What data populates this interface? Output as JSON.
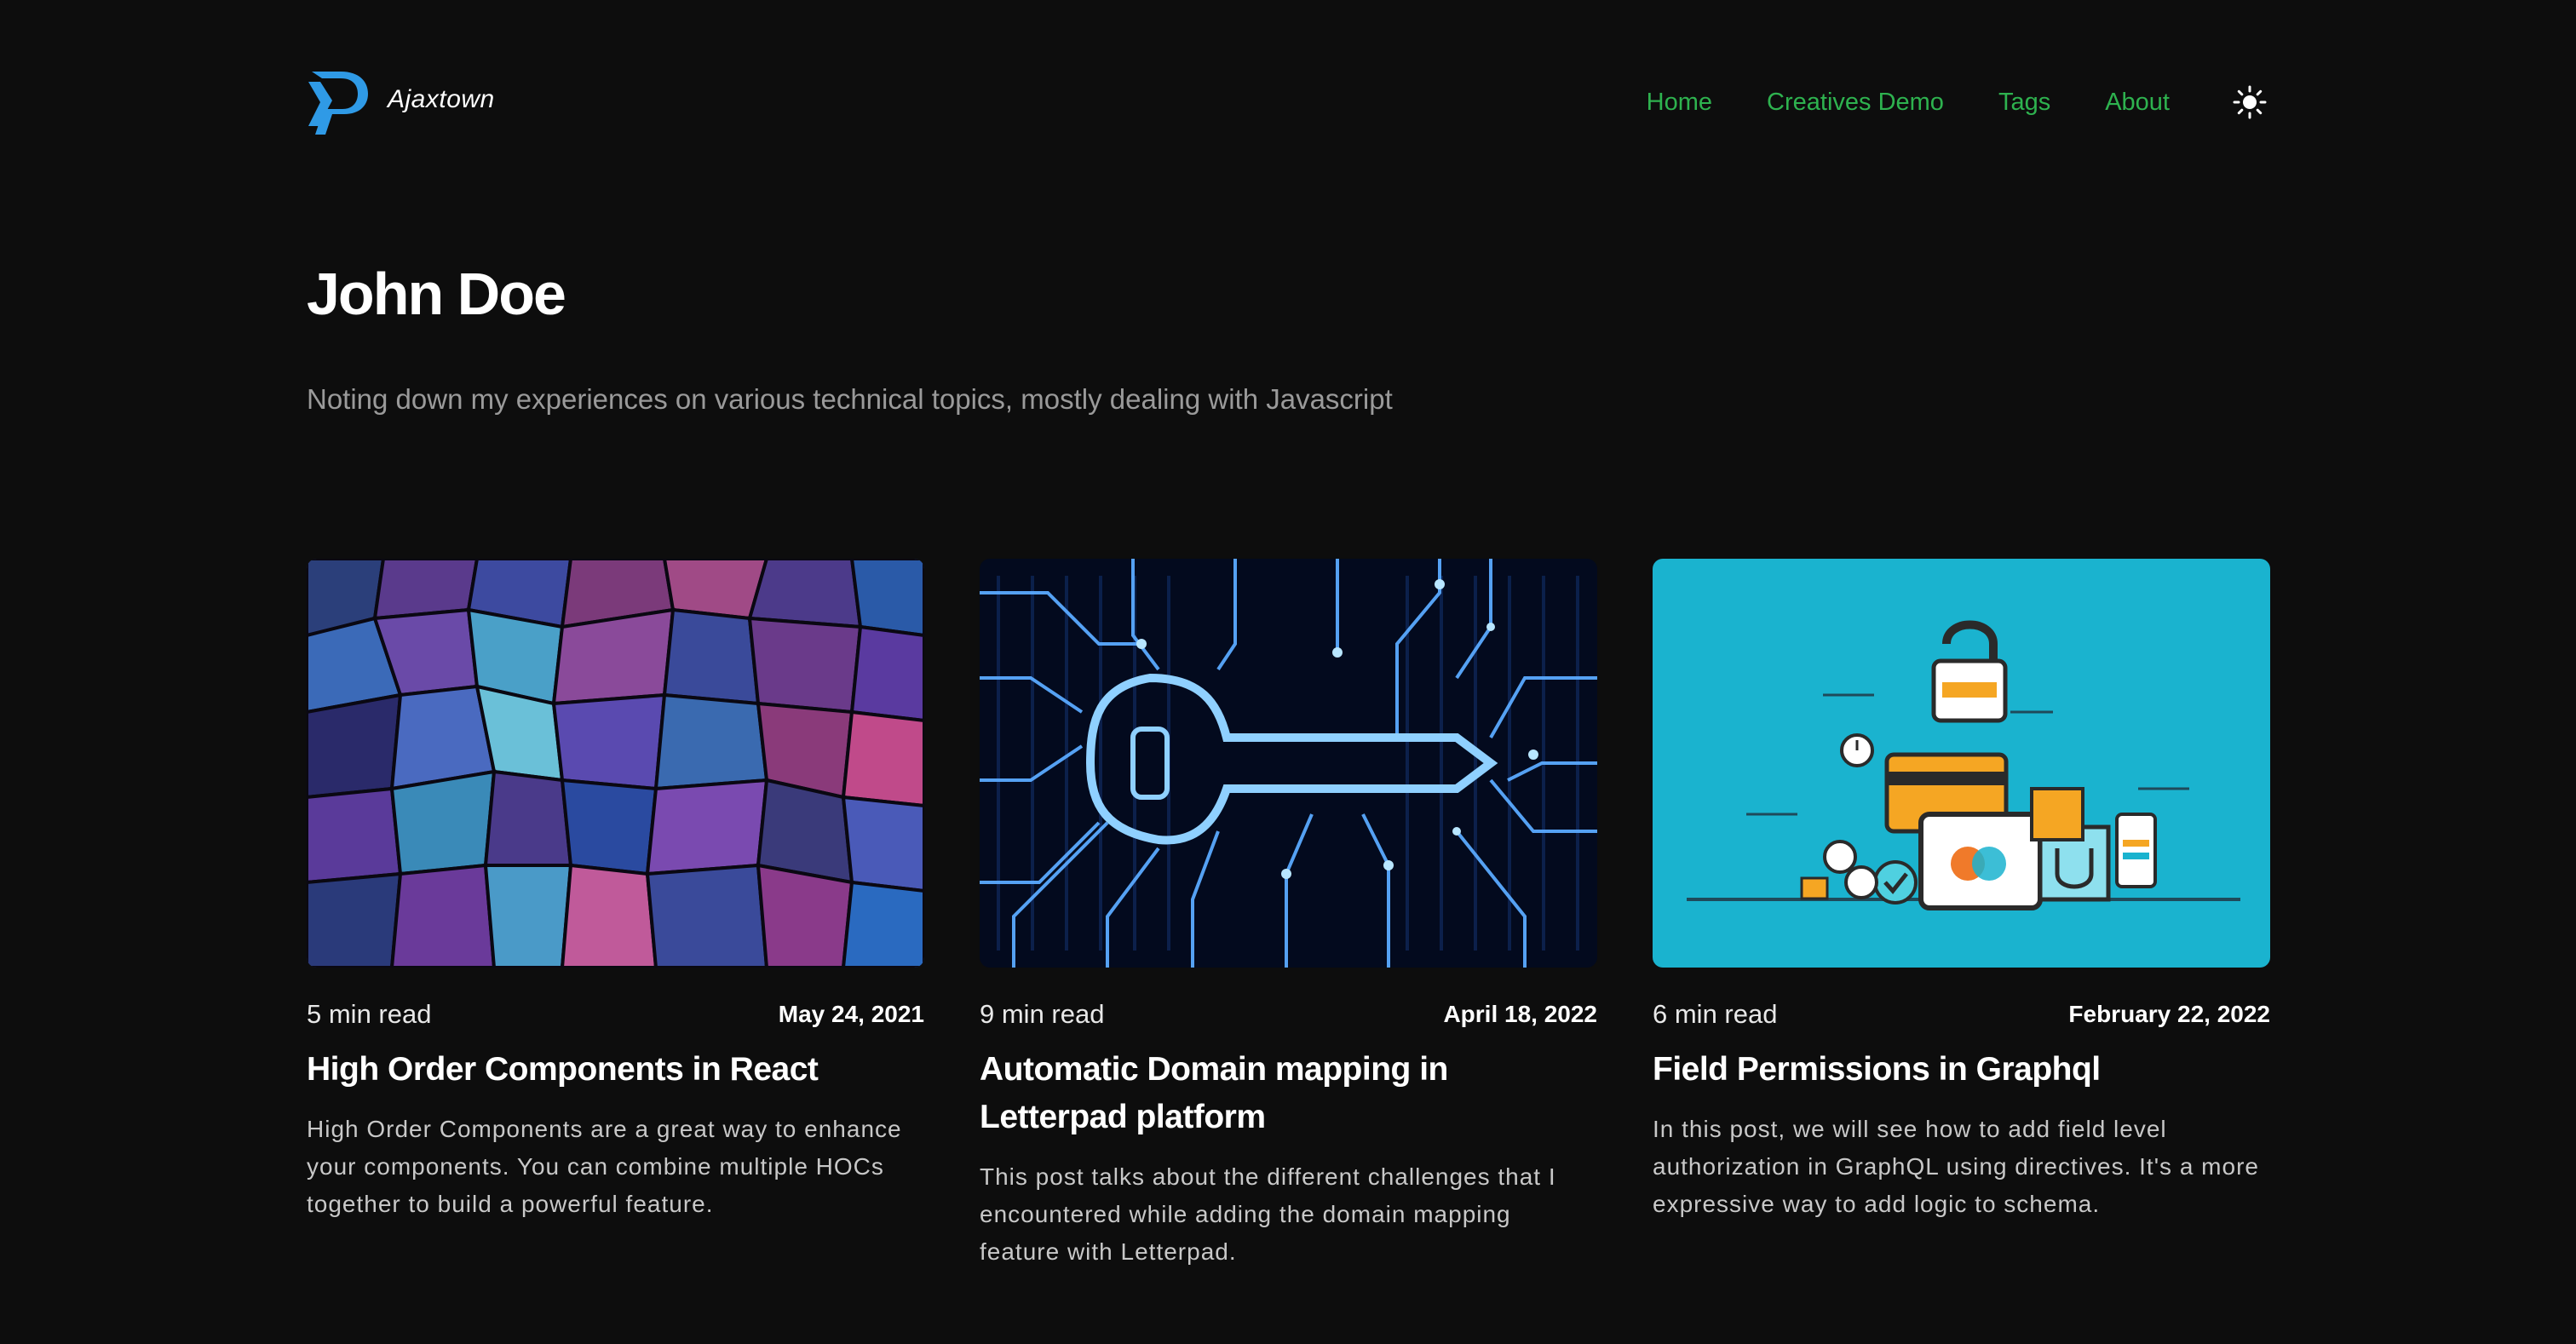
{
  "header": {
    "brand": "Ajaxtown",
    "nav": [
      {
        "label": "Home"
      },
      {
        "label": "Creatives Demo"
      },
      {
        "label": "Tags"
      },
      {
        "label": "About"
      }
    ],
    "theme_toggle_icon": "sun-icon"
  },
  "hero": {
    "title": "John Doe",
    "subtitle": "Noting down my experiences on various technical topics, mostly dealing with Javascript"
  },
  "posts": [
    {
      "read_time": "5 min read",
      "date": "May 24, 2021",
      "title": "High Order Components in React",
      "excerpt": "High Order Components are a great way to enhance your components. You can combine multiple HOCs together to build a powerful feature."
    },
    {
      "read_time": "9 min read",
      "date": "April 18, 2022",
      "title": "Automatic Domain mapping in Letterpad platform",
      "excerpt": "This post talks about the different challenges that I encountered while adding the domain mapping feature with Letterpad."
    },
    {
      "read_time": "6 min read",
      "date": "February 22, 2022",
      "title": "Field Permissions in Graphql",
      "excerpt": "In this post, we will see how to add field level authorization in GraphQL using directives. It's a more expressive way to add logic to schema."
    }
  ],
  "colors": {
    "background": "#0d0d0d",
    "nav_link": "#2eb24f",
    "logo_blue": "#2f9ae6",
    "card3_background": "#1ab3cf"
  }
}
